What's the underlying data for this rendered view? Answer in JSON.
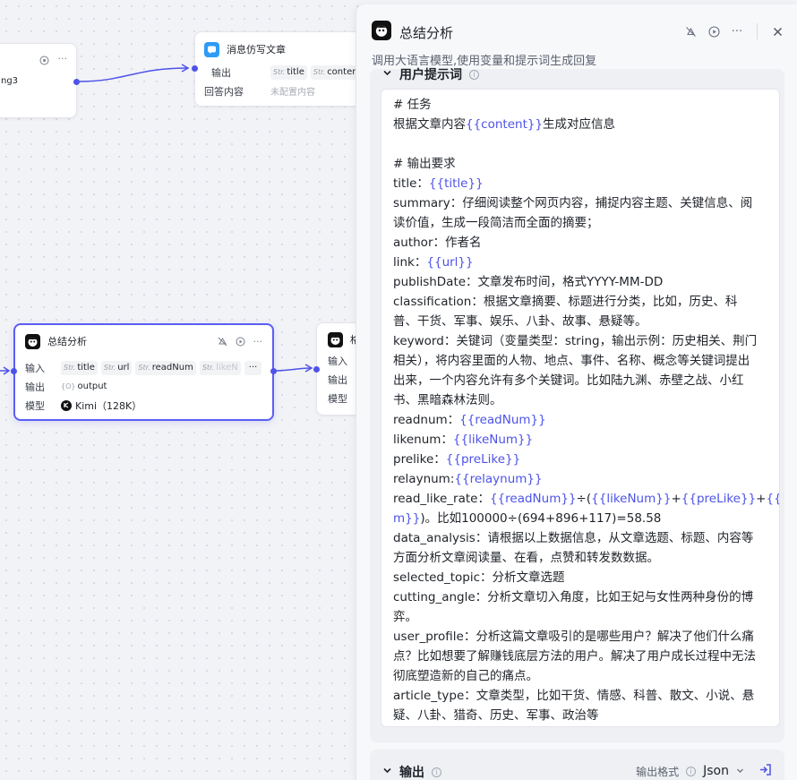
{
  "canvas": {
    "node_left_partial": {
      "text": "ng3"
    },
    "node_rewrite": {
      "title": "消息仿写文章",
      "output_label": "输出",
      "output_tags": [
        "title",
        "content"
      ],
      "answer_label": "回答内容",
      "answer_value": "未配置内容"
    },
    "node_summary": {
      "title": "总结分析",
      "input_label": "输入",
      "input_tags": [
        "title",
        "url",
        "readNum",
        "likeN"
      ],
      "output_label": "输出",
      "output_tag": "output",
      "model_label": "模型",
      "model_value": "Kimi（128K）"
    },
    "node_next_partial": {
      "title": "格",
      "input_label": "输入",
      "output_label": "输出",
      "model_label": "模型"
    },
    "str_prefix": "Str.",
    "obj_prefix": "{O}"
  },
  "panel": {
    "title": "总结分析",
    "description": "调用大语言模型,使用变量和提示词生成回复",
    "prompt_section": {
      "label": "用户提示词",
      "lines": [
        [
          {
            "t": "# 任务"
          }
        ],
        [
          {
            "t": "根据文章内容"
          },
          {
            "t": "{{content}}",
            "var": true
          },
          {
            "t": "生成对应信息"
          }
        ],
        [
          {
            "t": ""
          }
        ],
        [
          {
            "t": "# 输出要求"
          }
        ],
        [
          {
            "t": "title："
          },
          {
            "t": "{{title}}",
            "var": true
          }
        ],
        [
          {
            "t": "summary：仔细阅读整个网页内容，捕捉内容主题、关键信息、阅"
          }
        ],
        [
          {
            "t": "读价值，生成一段简洁而全面的摘要；"
          }
        ],
        [
          {
            "t": "author：作者名"
          }
        ],
        [
          {
            "t": "link："
          },
          {
            "t": "{{url}}",
            "var": true
          }
        ],
        [
          {
            "t": "publishDate：文章发布时间，格式YYYY-MM-DD"
          }
        ],
        [
          {
            "t": "classification：根据文章摘要、标题进行分类，比如，历史、科"
          }
        ],
        [
          {
            "t": "普、干货、军事、娱乐、八卦、故事、悬疑等。"
          }
        ],
        [
          {
            "t": "keyword：关键词（变量类型：string，输出示例：历史相关、荆门"
          }
        ],
        [
          {
            "t": "相关），将内容里面的人物、地点、事件、名称、概念等关键词提出"
          }
        ],
        [
          {
            "t": "出来，一个内容允许有多个关键词。比如陆九渊、赤壁之战、小红"
          }
        ],
        [
          {
            "t": "书、黑暗森林法则。"
          }
        ],
        [
          {
            "t": "readnum："
          },
          {
            "t": "{{readNum}}",
            "var": true
          }
        ],
        [
          {
            "t": "likenum："
          },
          {
            "t": "{{likeNum}}",
            "var": true
          }
        ],
        [
          {
            "t": "prelike："
          },
          {
            "t": "{{preLike}}",
            "var": true
          }
        ],
        [
          {
            "t": "relaynum:"
          },
          {
            "t": "{{relaynum}}",
            "var": true
          }
        ],
        [
          {
            "t": "read_like_rate："
          },
          {
            "t": "{{readNum}}",
            "var": true
          },
          {
            "t": "÷("
          },
          {
            "t": "{{likeNum}}",
            "var": true
          },
          {
            "t": "+"
          },
          {
            "t": "{{preLike}}",
            "var": true
          },
          {
            "t": "+"
          },
          {
            "t": "{{relaynu",
            "var": true
          }
        ],
        [
          {
            "t": "m}}",
            "var": true
          },
          {
            "t": ")。比如100000÷(694+896+117)=58.58"
          }
        ],
        [
          {
            "t": "data_analysis：请根据以上数据信息，从文章选题、标题、内容等"
          }
        ],
        [
          {
            "t": "方面分析文章阅读量、在看，点赞和转发数数据。"
          }
        ],
        [
          {
            "t": "selected_topic：分析文章选题"
          }
        ],
        [
          {
            "t": "cutting_angle：分析文章切入角度，比如王妃与女性两种身份的博"
          }
        ],
        [
          {
            "t": "弈。"
          }
        ],
        [
          {
            "t": "user_profile：分析这篇文章吸引的是哪些用户？解决了他们什么痛"
          }
        ],
        [
          {
            "t": "点？比如想要了解赚钱底层方法的用户。解决了用户成长过程中无法"
          }
        ],
        [
          {
            "t": "彻底塑造新的自己的痛点。"
          }
        ],
        [
          {
            "t": "article_type：文章类型，比如干货、情感、科普、散文、小说、悬"
          }
        ],
        [
          {
            "t": "疑、八卦、猎奇、历史、军事、政治等"
          }
        ]
      ]
    },
    "output_section": {
      "label": "输出",
      "format_label": "输出格式",
      "format_value": "Json"
    }
  }
}
